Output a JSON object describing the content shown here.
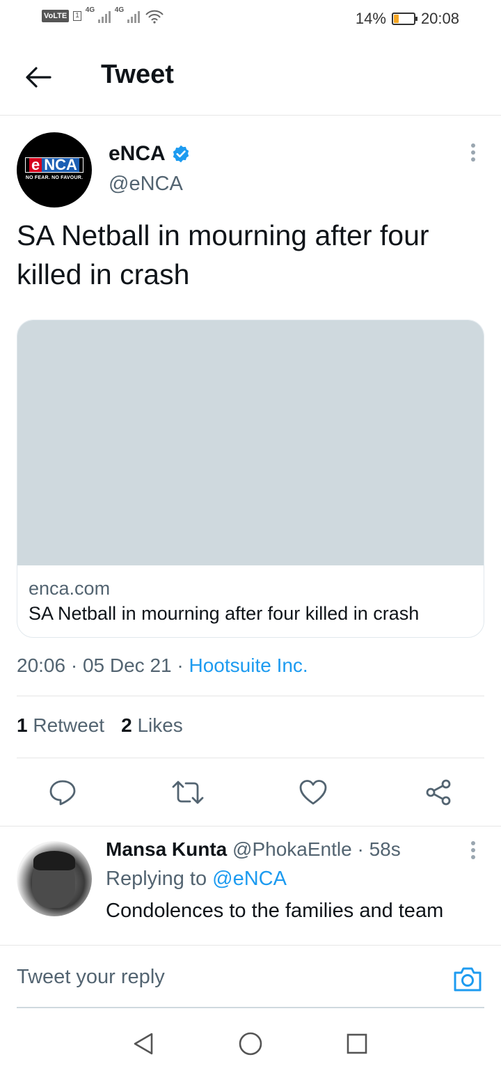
{
  "status_bar": {
    "volte": "VoLTE",
    "sim1": "1",
    "net1": "4G",
    "net2": "4G",
    "battery_percent": "14%",
    "battery_level": 0.14,
    "time": "20:08"
  },
  "header": {
    "title": "Tweet",
    "back_icon": "arrow-left-icon"
  },
  "tweet": {
    "avatar_logo_e": "e",
    "avatar_logo_nca": "NCA",
    "avatar_tagline": "NO FEAR. NO FAVOUR.",
    "author_name": "eNCA",
    "author_handle": "@eNCA",
    "verified_icon": "verified-badge-icon",
    "text": "SA Netball in mourning after four killed in crash",
    "card": {
      "domain": "enca.com",
      "title": "SA Netball in mourning after four killed in crash"
    },
    "time": "20:06",
    "date": "05 Dec 21",
    "source": "Hootsuite Inc.",
    "separator": "·",
    "stats": {
      "retweets_count": "1",
      "retweets_label": "Retweet",
      "likes_count": "2",
      "likes_label": "Likes"
    },
    "actions": {
      "reply_icon": "reply-icon",
      "retweet_icon": "retweet-icon",
      "like_icon": "heart-icon",
      "share_icon": "share-icon"
    }
  },
  "reply": {
    "name": "Mansa Kunta",
    "handle": "@PhokaEntle",
    "separator": "·",
    "age": "58s",
    "replying_prefix": "Replying to",
    "replying_to": "@eNCA",
    "text": "Condolences to the families and team"
  },
  "compose": {
    "placeholder": "Tweet your reply",
    "camera_icon": "camera-icon"
  },
  "navbar": {
    "back_icon": "nav-back-icon",
    "home_icon": "nav-home-icon",
    "recents_icon": "nav-recents-icon"
  },
  "colors": {
    "accent": "#1d9bf0",
    "secondary_text": "#536471",
    "primary_text": "#0f1419",
    "card_image": "#cfd9de"
  }
}
